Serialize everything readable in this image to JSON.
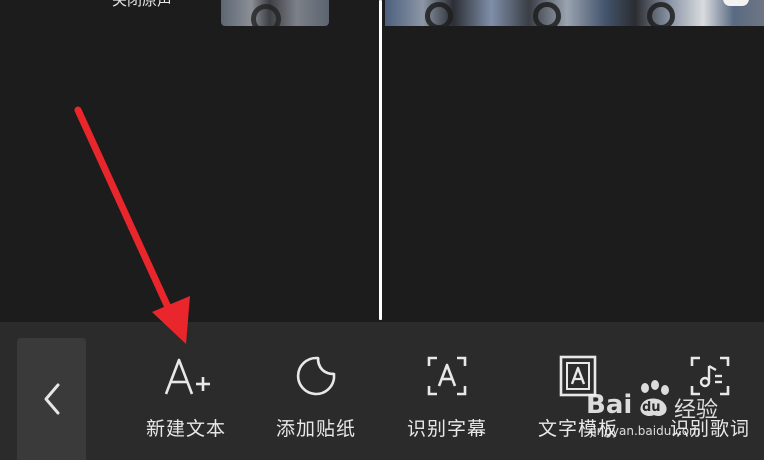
{
  "timeline": {
    "audio_mute_label": "关闭原声"
  },
  "toolbar": {
    "back_icon": "chevron-left-icon",
    "tools": [
      {
        "label": "新建文本",
        "icon": "add-text-icon"
      },
      {
        "label": "添加贴纸",
        "icon": "sticker-icon"
      },
      {
        "label": "识别字幕",
        "icon": "recognize-subtitle-icon"
      },
      {
        "label": "文字模板",
        "icon": "text-template-icon"
      },
      {
        "label": "识别歌词",
        "icon": "recognize-lyrics-icon"
      }
    ]
  },
  "watermark": {
    "brand_left": "Bai",
    "brand_right": "du",
    "brand_cn": "经验",
    "url": "jingyan.baidu.com"
  },
  "annotation": {
    "arrow_color": "#e8262b"
  }
}
